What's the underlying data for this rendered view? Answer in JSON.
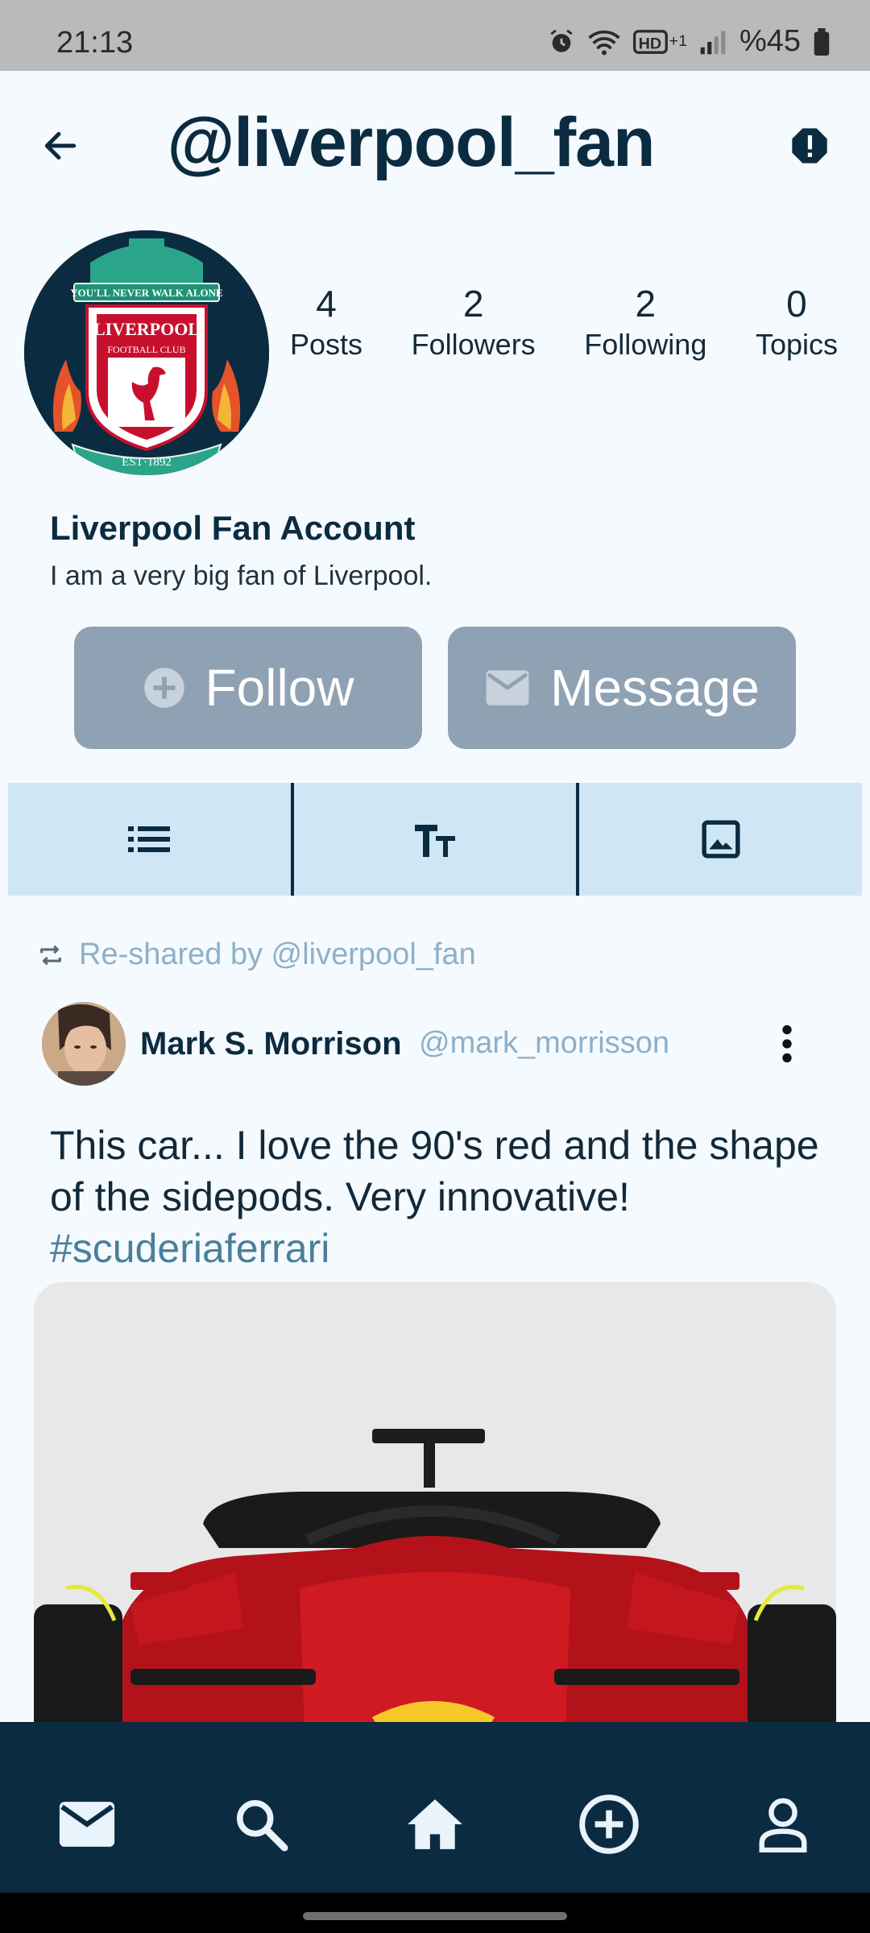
{
  "status_bar": {
    "time": "21:13",
    "battery": "%45"
  },
  "header": {
    "handle": "@liverpool_fan"
  },
  "profile": {
    "display_name": "Liverpool Fan Account",
    "bio": "I am  a very big fan of Liverpool.",
    "avatar_crest_text": [
      "YOU'LL NEVER WALK ALONE",
      "LIVERPOOL",
      "FOOTBALL CLUB",
      "EST·1892"
    ]
  },
  "stats": [
    {
      "value": "4",
      "label": "Posts"
    },
    {
      "value": "2",
      "label": "Followers"
    },
    {
      "value": "2",
      "label": "Following"
    },
    {
      "value": "0",
      "label": "Topics"
    }
  ],
  "actions": {
    "follow_label": "Follow",
    "message_label": "Message"
  },
  "tabs": [
    {
      "icon": "list-icon"
    },
    {
      "icon": "text-format-icon"
    },
    {
      "icon": "image-icon"
    }
  ],
  "post": {
    "reshared_by": "Re-shared by @liverpool_fan",
    "author_name": "Mark S. Morrison",
    "author_handle": "@mark_morrisson",
    "text": "This car... I love the 90's red and the shape of the sidepods. Very innovative!",
    "hashtag": "#scuderiaferrari",
    "image_description_icon": "formula-one-car-image"
  },
  "bottom_nav": [
    {
      "icon": "mail-icon"
    },
    {
      "icon": "search-icon"
    },
    {
      "icon": "home-icon"
    },
    {
      "icon": "add-circle-icon"
    },
    {
      "icon": "profile-icon"
    }
  ],
  "colors": {
    "primary": "#0b2b40",
    "background": "#f4fafe",
    "button_disabled": "#8fa2b4",
    "tab_bar": "#cfe6f5",
    "muted_text": "#8fb0c8",
    "hashtag": "#4a7f9c"
  }
}
